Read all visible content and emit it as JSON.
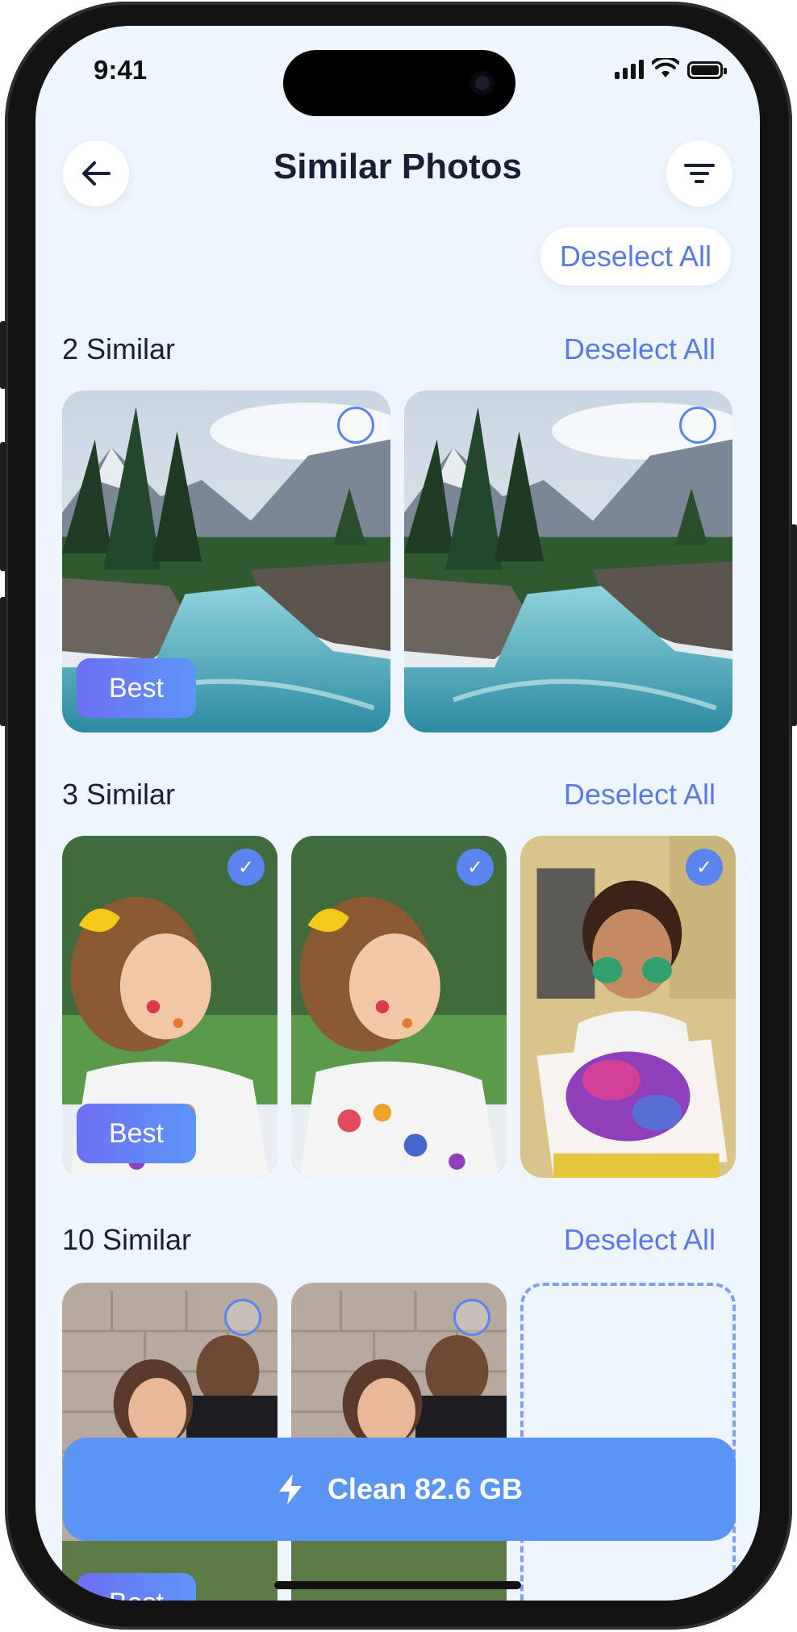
{
  "status": {
    "time": "9:41"
  },
  "header": {
    "title": "Similar Photos",
    "deselect_all": "Deselect All"
  },
  "groups": [
    {
      "title": "2 Similar",
      "action": "Deselect All",
      "best_label": "Best"
    },
    {
      "title": "3 Similar",
      "action": "Deselect All",
      "best_label": "Best"
    },
    {
      "title": "10 Similar",
      "action": "Deselect All",
      "best_label": "Best"
    }
  ],
  "clean_button": {
    "label": "Clean 82.6 GB"
  },
  "icons": {
    "back": "arrow-left-icon",
    "filter": "filter-icon",
    "clean": "lightning-icon",
    "selected": "checkmark-icon"
  },
  "colors": {
    "accent": "#5a79e6",
    "button": "#5a95f5",
    "background": "#eef5fc"
  }
}
